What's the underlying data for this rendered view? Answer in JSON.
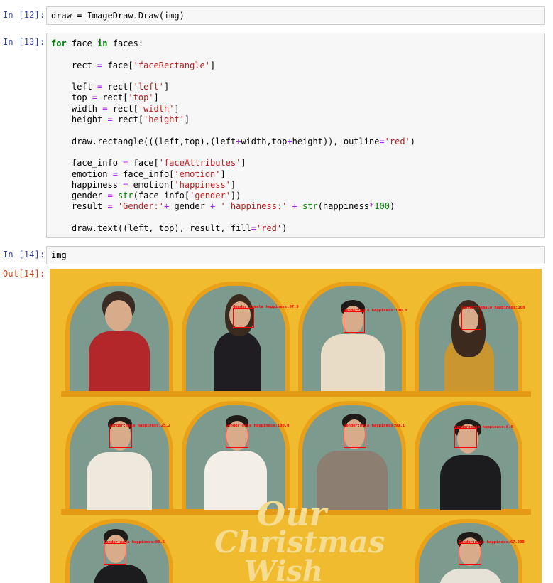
{
  "cells": [
    {
      "prompt": "In [12]:",
      "code": [
        [
          {
            "t": "draw = ImageDraw.Draw(img)"
          }
        ]
      ]
    },
    {
      "prompt": "In [13]:",
      "code": [
        [
          {
            "t": "for",
            "c": "kw"
          },
          {
            "t": " face "
          },
          {
            "t": "in",
            "c": "kw"
          },
          {
            "t": " faces:"
          }
        ],
        [
          {
            "t": ""
          }
        ],
        [
          {
            "t": "    rect "
          },
          {
            "t": "=",
            "c": "op"
          },
          {
            "t": " face["
          },
          {
            "t": "'faceRectangle'",
            "c": "str"
          },
          {
            "t": "]"
          }
        ],
        [
          {
            "t": ""
          }
        ],
        [
          {
            "t": "    left "
          },
          {
            "t": "=",
            "c": "op"
          },
          {
            "t": " rect["
          },
          {
            "t": "'left'",
            "c": "str"
          },
          {
            "t": "]"
          }
        ],
        [
          {
            "t": "    top "
          },
          {
            "t": "=",
            "c": "op"
          },
          {
            "t": " rect["
          },
          {
            "t": "'top'",
            "c": "str"
          },
          {
            "t": "]"
          }
        ],
        [
          {
            "t": "    width "
          },
          {
            "t": "=",
            "c": "op"
          },
          {
            "t": " rect["
          },
          {
            "t": "'width'",
            "c": "str"
          },
          {
            "t": "]"
          }
        ],
        [
          {
            "t": "    height "
          },
          {
            "t": "=",
            "c": "op"
          },
          {
            "t": " rect["
          },
          {
            "t": "'height'",
            "c": "str"
          },
          {
            "t": "]"
          }
        ],
        [
          {
            "t": ""
          }
        ],
        [
          {
            "t": "    draw.rectangle(((left,top),(left"
          },
          {
            "t": "+",
            "c": "op"
          },
          {
            "t": "width,top"
          },
          {
            "t": "+",
            "c": "op"
          },
          {
            "t": "height)), outline"
          },
          {
            "t": "=",
            "c": "op"
          },
          {
            "t": "'red'",
            "c": "str"
          },
          {
            "t": ")"
          }
        ],
        [
          {
            "t": ""
          }
        ],
        [
          {
            "t": "    face_info "
          },
          {
            "t": "=",
            "c": "op"
          },
          {
            "t": " face["
          },
          {
            "t": "'faceAttributes'",
            "c": "str"
          },
          {
            "t": "]"
          }
        ],
        [
          {
            "t": "    emotion "
          },
          {
            "t": "=",
            "c": "op"
          },
          {
            "t": " face_info["
          },
          {
            "t": "'emotion'",
            "c": "str"
          },
          {
            "t": "]"
          }
        ],
        [
          {
            "t": "    happiness "
          },
          {
            "t": "=",
            "c": "op"
          },
          {
            "t": " emotion["
          },
          {
            "t": "'happiness'",
            "c": "str"
          },
          {
            "t": "]"
          }
        ],
        [
          {
            "t": "    gender "
          },
          {
            "t": "=",
            "c": "op"
          },
          {
            "t": " "
          },
          {
            "t": "str",
            "c": "bi"
          },
          {
            "t": "(face_info["
          },
          {
            "t": "'gender'",
            "c": "str"
          },
          {
            "t": "])"
          }
        ],
        [
          {
            "t": "    result "
          },
          {
            "t": "=",
            "c": "op"
          },
          {
            "t": " "
          },
          {
            "t": "'Gender:'",
            "c": "str"
          },
          {
            "t": "+",
            "c": "op"
          },
          {
            "t": " gender "
          },
          {
            "t": "+",
            "c": "op"
          },
          {
            "t": " "
          },
          {
            "t": "' happiness:'",
            "c": "str"
          },
          {
            "t": " "
          },
          {
            "t": "+",
            "c": "op"
          },
          {
            "t": " "
          },
          {
            "t": "str",
            "c": "bi"
          },
          {
            "t": "(happiness"
          },
          {
            "t": "*",
            "c": "op"
          },
          {
            "t": "100",
            "c": "num"
          },
          {
            "t": ")"
          }
        ],
        [
          {
            "t": ""
          }
        ],
        [
          {
            "t": "    draw.text((left, top), result, fill"
          },
          {
            "t": "=",
            "c": "op"
          },
          {
            "t": "'red'",
            "c": "str"
          },
          {
            "t": ")"
          }
        ]
      ]
    },
    {
      "prompt": "In [14]:",
      "code": [
        [
          {
            "t": "img"
          }
        ]
      ]
    }
  ],
  "output": {
    "prompt": "Out[14]:",
    "face_labels": [
      "Gender:female happiness:97.9",
      "Gender:male happiness:100.0",
      "Gender:female happiness:100",
      "Gender:male happiness:25.2",
      "Gender:male happiness:100.0",
      "Gender:male happiness:99.1",
      "Gender:male happiness:0.0",
      "Gender:male happiness:98.5",
      "Gender:male happiness:67.800"
    ],
    "poster_title": [
      "Our",
      "Christmas",
      "Wish"
    ],
    "colors": {
      "background": "#f0bb2e",
      "arch": "#e9a11a",
      "wall": "#7d9a8e",
      "box": "#ff0000"
    }
  }
}
